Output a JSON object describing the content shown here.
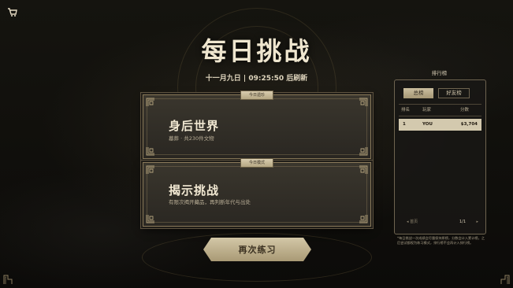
{
  "header": {
    "title": "每日挑战",
    "date": "十一月九日",
    "separator": "|",
    "countdown": "09:25:50",
    "refresh_suffix": "后刷新"
  },
  "cards": [
    {
      "tag": "今日遗珍",
      "heading": "身后世界",
      "subtitle": "墓葬 · 共230件文物"
    },
    {
      "tag": "今日模式",
      "heading": "揭示挑战",
      "subtitle": "有限次揭开藏品，再判断年代与出处"
    }
  ],
  "replay_button": {
    "label": "再次练习"
  },
  "leaderboard": {
    "title": "排行榜",
    "tabs": [
      "总榜",
      "好友榜"
    ],
    "active_tab": "总榜",
    "columns": [
      "排名",
      "玩家",
      "分数"
    ],
    "rows": [
      {
        "rank": "1",
        "player": "YOU",
        "score": "$3,704"
      }
    ],
    "pager": {
      "prev": "◂ 首页",
      "page": "1/1",
      "next": "▸"
    },
    "note": "*每日挑战一次成绩会尽量保持原榜，分数会计入累计榜。之后尝试都视为练习模式，排行榜不会再计入排行榜。"
  },
  "colors": {
    "accent_gold": "#d3c7a7",
    "title_text": "#efe6cf",
    "card_bg": "#2a2722"
  },
  "icons": [
    "shop-cart-icon",
    "corner-ornament-icon",
    "knot-ornament-icon"
  ]
}
